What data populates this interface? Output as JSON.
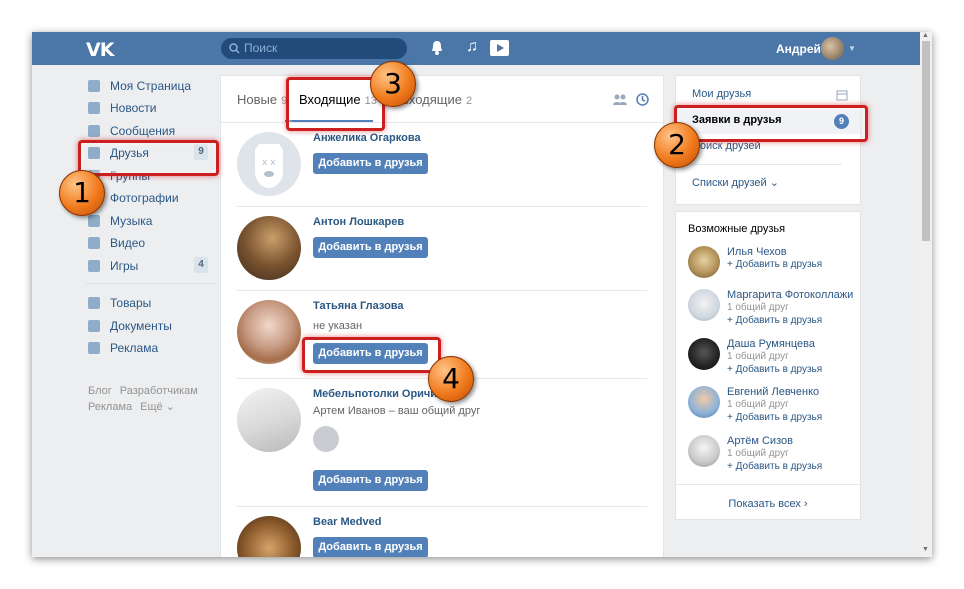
{
  "topbar": {
    "logo": "VK",
    "search_placeholder": "Поиск",
    "user_name": "Андрей"
  },
  "nav": {
    "items": [
      {
        "label": "Моя Страница",
        "icon": "home-icon"
      },
      {
        "label": "Новости",
        "icon": "news-icon"
      },
      {
        "label": "Сообщения",
        "icon": "message-icon"
      },
      {
        "label": "Друзья",
        "icon": "user-icon",
        "badge": "9"
      },
      {
        "label": "Группы",
        "icon": "group-icon"
      },
      {
        "label": "Фотографии",
        "icon": "photo-icon"
      },
      {
        "label": "Музыка",
        "icon": "music-icon"
      },
      {
        "label": "Видео",
        "icon": "video-icon"
      },
      {
        "label": "Игры",
        "icon": "gamepad-icon",
        "badge": "4"
      },
      {
        "label": "Товары",
        "icon": "bag-icon"
      },
      {
        "label": "Документы",
        "icon": "document-icon"
      },
      {
        "label": "Реклама",
        "icon": "megaphone-icon"
      }
    ],
    "footer": {
      "blog": "Блог",
      "devs": "Разработчикам",
      "ads": "Реклама",
      "more": "Ещё ⌄"
    }
  },
  "tabs": [
    {
      "label": "Новые",
      "count": "9"
    },
    {
      "label": "Входящие",
      "count": "13"
    },
    {
      "label": "Исходящие",
      "count": "2"
    }
  ],
  "requests": [
    {
      "name": "Анжелика Огаркова",
      "sub": "",
      "button": "Добавить в друзья"
    },
    {
      "name": "Антон Лошкарев",
      "sub": "",
      "button": "Добавить в друзья"
    },
    {
      "name": "Татьяна Глазова",
      "sub": "не указан",
      "button": "Добавить в друзья"
    },
    {
      "name": "Мебельпотолки Оричи",
      "sub": "Артем Иванов – ваш общий друг",
      "button": "Добавить в друзья"
    },
    {
      "name": "Bear Medved",
      "sub": "",
      "button": "Добавить в друзья"
    }
  ],
  "right_menu": [
    {
      "label": "Мои друзья"
    },
    {
      "label": "Заявки в друзья",
      "badge": "9"
    },
    {
      "label": "Поиск друзей"
    },
    {
      "label": "Списки друзей ⌄"
    }
  ],
  "possible_friends": {
    "title": "Возможные друзья",
    "items": [
      {
        "name": "Илья Чехов",
        "common": "",
        "add": "+ Добавить в друзья"
      },
      {
        "name": "Маргарита Фотоколлажи",
        "common": "1 общий друг",
        "add": "+ Добавить в друзья"
      },
      {
        "name": "Даша Румянцева",
        "common": "1 общий друг",
        "add": "+ Добавить в друзья"
      },
      {
        "name": "Евгений Левченко",
        "common": "1 общий друг",
        "add": "+ Добавить в друзья"
      },
      {
        "name": "Артём Сизов",
        "common": "1 общий друг",
        "add": "+ Добавить в друзья"
      }
    ],
    "show_all": "Показать всех ›"
  },
  "annotations": {
    "m1": "1",
    "m2": "2",
    "m3": "3",
    "m4": "4"
  },
  "colors": {
    "header": "#4a76a8",
    "accent": "#5181b8",
    "link": "#2a5885",
    "highlight": "#cc1f1f",
    "marker": "#f07a1c"
  }
}
